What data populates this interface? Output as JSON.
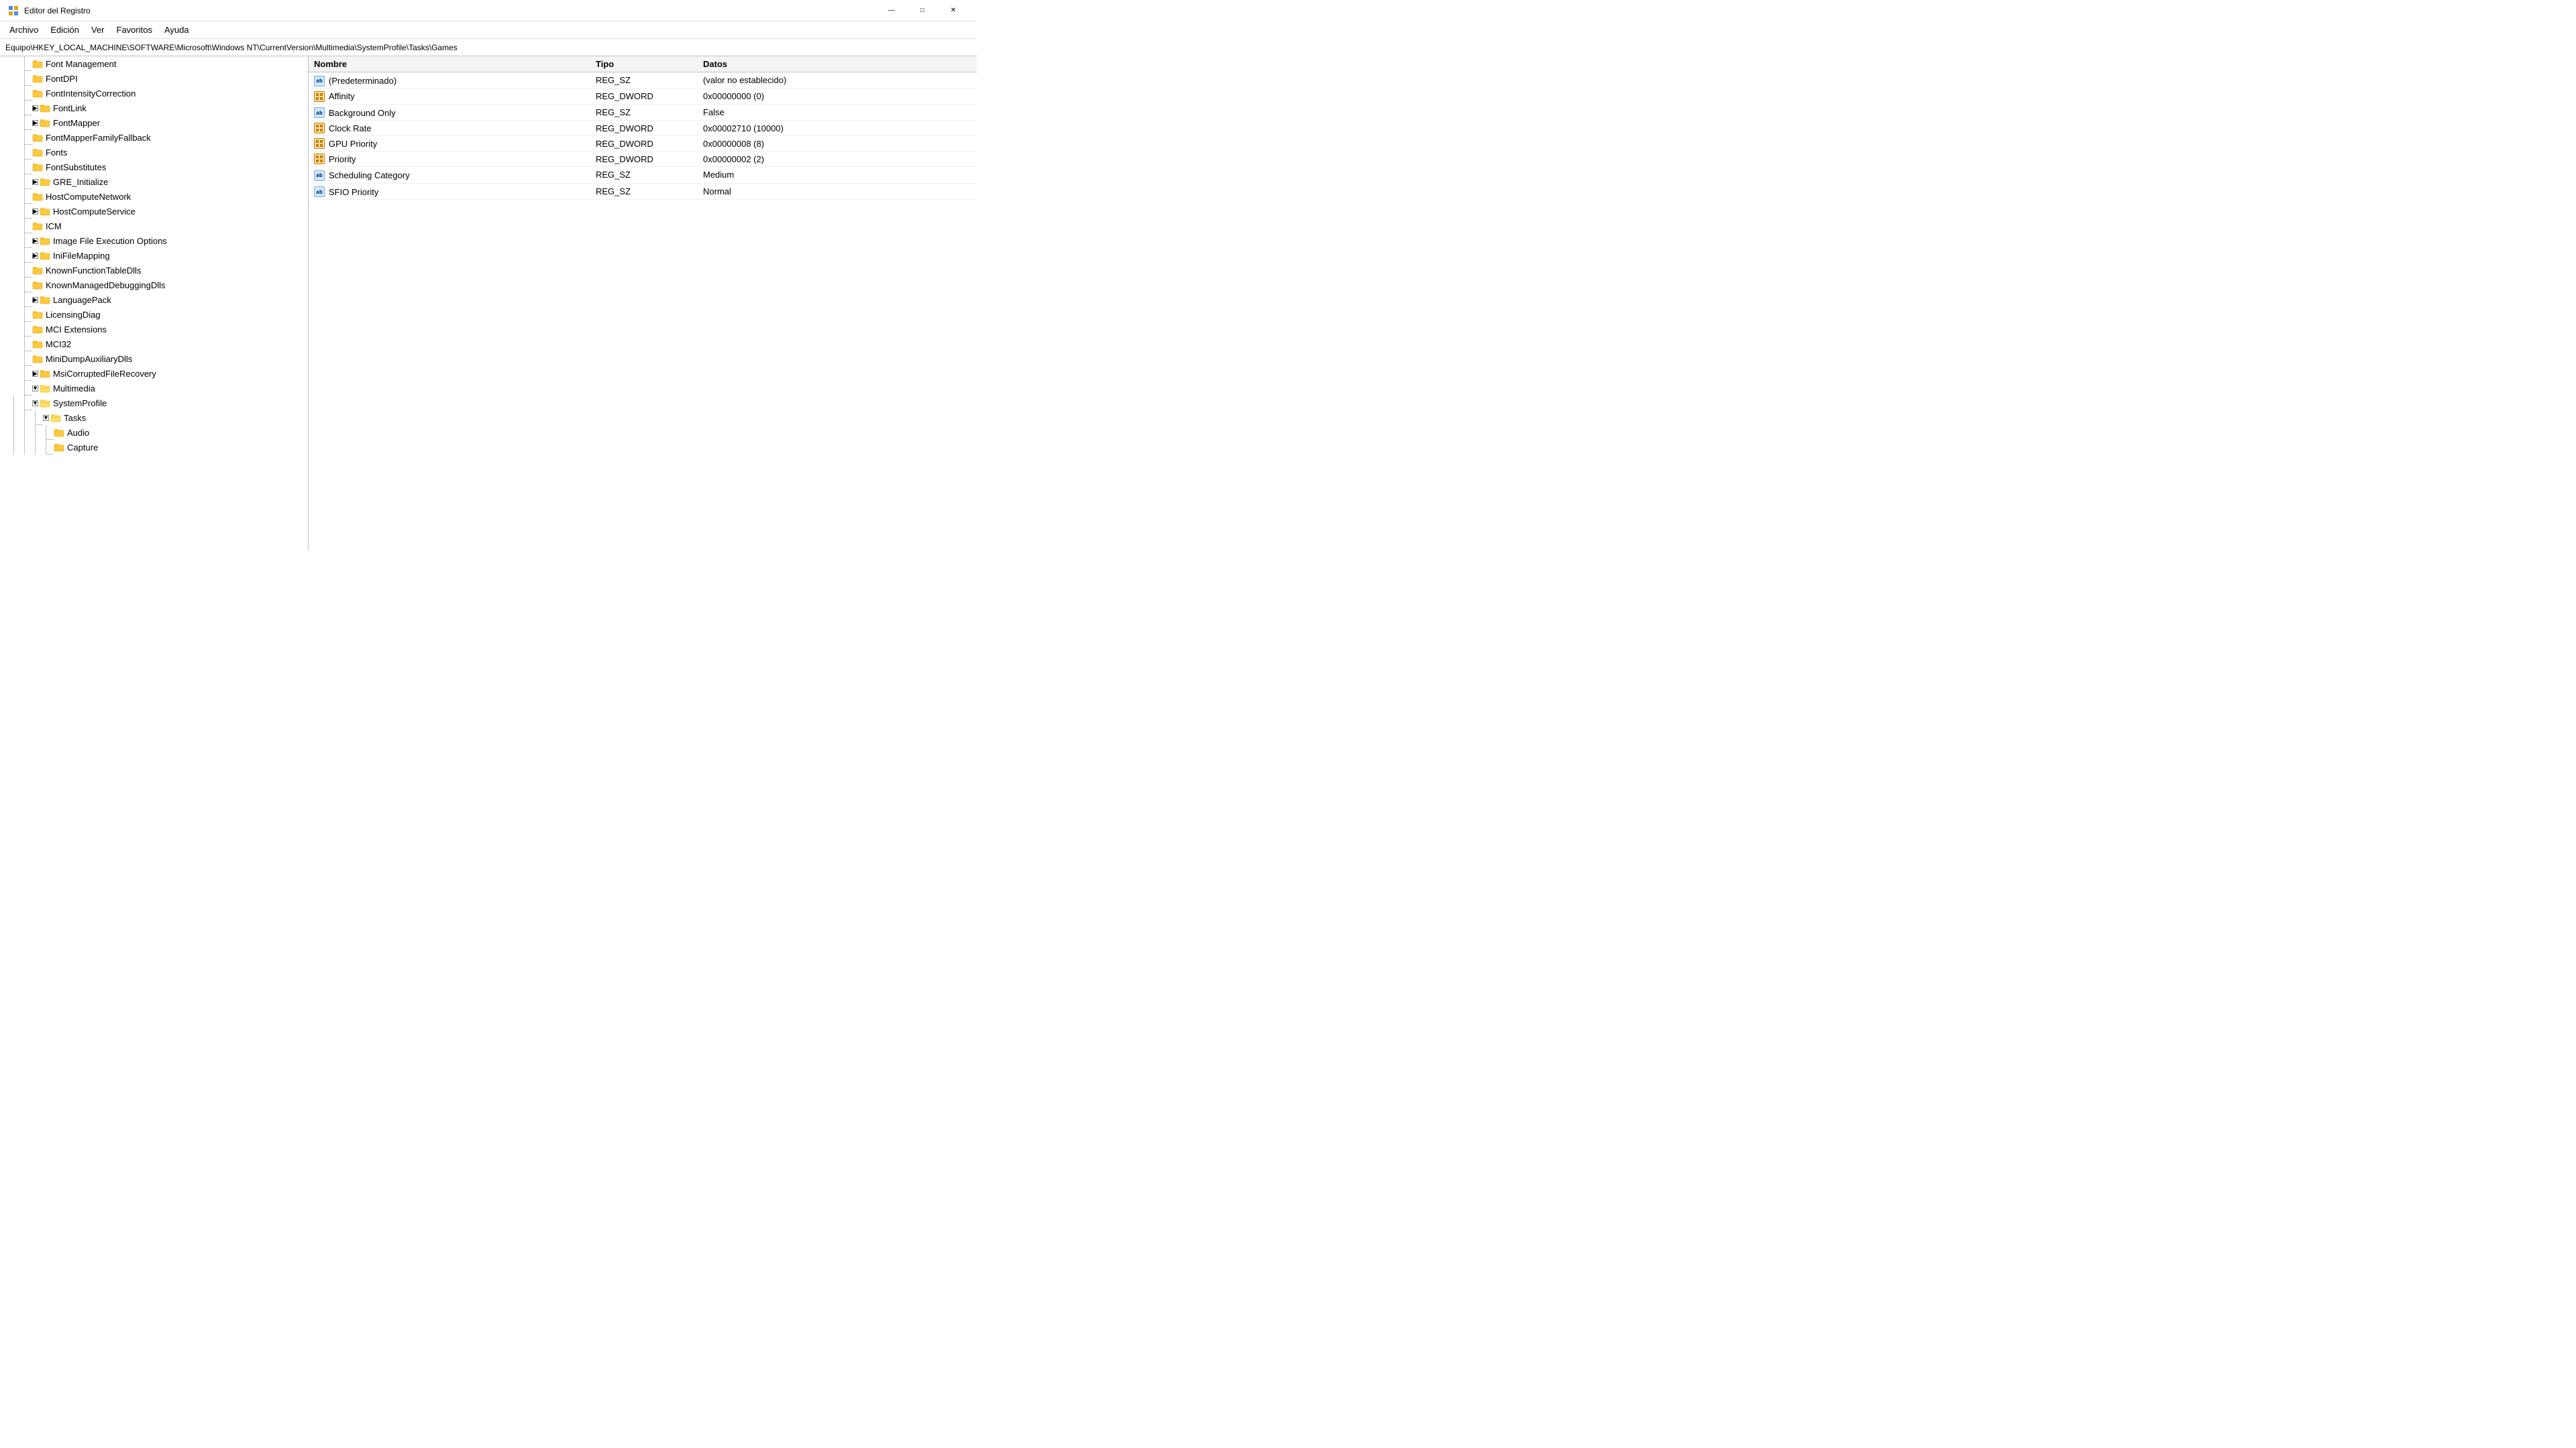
{
  "titleBar": {
    "icon": "registry-editor-icon",
    "title": "Editor del Registro",
    "minimizeBtn": "—",
    "maximizeBtn": "□",
    "closeBtn": "✕"
  },
  "menuBar": {
    "items": [
      "Archivo",
      "Edición",
      "Ver",
      "Favoritos",
      "Ayuda"
    ]
  },
  "breadcrumb": "Equipo\\HKEY_LOCAL_MACHINE\\SOFTWARE\\Microsoft\\Windows NT\\CurrentVersion\\Multimedia\\SystemProfile\\Tasks\\Games",
  "treePanel": {
    "items": [
      {
        "id": "font-management",
        "label": "Font Management",
        "depth": 1,
        "hasChildren": false,
        "expanded": false,
        "isLast": false
      },
      {
        "id": "fontdpi",
        "label": "FontDPI",
        "depth": 1,
        "hasChildren": false,
        "expanded": false,
        "isLast": false
      },
      {
        "id": "fontintensitycorrection",
        "label": "FontIntensityCorrection",
        "depth": 1,
        "hasChildren": false,
        "expanded": false,
        "isLast": false
      },
      {
        "id": "fontlink",
        "label": "FontLink",
        "depth": 1,
        "hasChildren": true,
        "expanded": false,
        "isLast": false
      },
      {
        "id": "fontmapper",
        "label": "FontMapper",
        "depth": 1,
        "hasChildren": true,
        "expanded": false,
        "isLast": false
      },
      {
        "id": "fontmapperfamilyfallback",
        "label": "FontMapperFamilyFallback",
        "depth": 1,
        "hasChildren": false,
        "expanded": false,
        "isLast": false
      },
      {
        "id": "fonts",
        "label": "Fonts",
        "depth": 1,
        "hasChildren": false,
        "expanded": false,
        "isLast": false
      },
      {
        "id": "fontsubstitutes",
        "label": "FontSubstitutes",
        "depth": 1,
        "hasChildren": false,
        "expanded": false,
        "isLast": false
      },
      {
        "id": "gre-initialize",
        "label": "GRE_Initialize",
        "depth": 1,
        "hasChildren": true,
        "expanded": false,
        "isLast": false
      },
      {
        "id": "hostcomputenetwork",
        "label": "HostComputeNetwork",
        "depth": 1,
        "hasChildren": false,
        "expanded": false,
        "isLast": false
      },
      {
        "id": "hostcomputeservice",
        "label": "HostComputeService",
        "depth": 1,
        "hasChildren": true,
        "expanded": false,
        "isLast": false
      },
      {
        "id": "icm",
        "label": "ICM",
        "depth": 1,
        "hasChildren": false,
        "expanded": false,
        "isLast": false
      },
      {
        "id": "imagefileexecutionoptions",
        "label": "Image File Execution Options",
        "depth": 1,
        "hasChildren": true,
        "expanded": false,
        "isLast": false
      },
      {
        "id": "inifilemapping",
        "label": "IniFileMapping",
        "depth": 1,
        "hasChildren": true,
        "expanded": false,
        "isLast": false
      },
      {
        "id": "knownfunctiontabledlls",
        "label": "KnownFunctionTableDlls",
        "depth": 1,
        "hasChildren": false,
        "expanded": false,
        "isLast": false
      },
      {
        "id": "knownmanageddebuggingdlls",
        "label": "KnownManagedDebuggingDlls",
        "depth": 1,
        "hasChildren": false,
        "expanded": false,
        "isLast": false
      },
      {
        "id": "languagepack",
        "label": "LanguagePack",
        "depth": 1,
        "hasChildren": true,
        "expanded": false,
        "isLast": false
      },
      {
        "id": "licensingdiag",
        "label": "LicensingDiag",
        "depth": 1,
        "hasChildren": false,
        "expanded": false,
        "isLast": false
      },
      {
        "id": "mciextensions",
        "label": "MCI Extensions",
        "depth": 1,
        "hasChildren": false,
        "expanded": false,
        "isLast": false
      },
      {
        "id": "mci32",
        "label": "MCI32",
        "depth": 1,
        "hasChildren": false,
        "expanded": false,
        "isLast": false
      },
      {
        "id": "minidumpauxiliarydlls",
        "label": "MiniDumpAuxiliaryDlls",
        "depth": 1,
        "hasChildren": false,
        "expanded": false,
        "isLast": false
      },
      {
        "id": "msicorruptedfilerecovery",
        "label": "MsiCorruptedFileRecovery",
        "depth": 1,
        "hasChildren": true,
        "expanded": false,
        "isLast": false
      },
      {
        "id": "multimedia",
        "label": "Multimedia",
        "depth": 1,
        "hasChildren": true,
        "expanded": true,
        "isLast": false
      },
      {
        "id": "systemprofile",
        "label": "SystemProfile",
        "depth": 2,
        "hasChildren": true,
        "expanded": true,
        "isLast": false
      },
      {
        "id": "tasks",
        "label": "Tasks",
        "depth": 3,
        "hasChildren": true,
        "expanded": true,
        "isLast": false
      },
      {
        "id": "audio",
        "label": "Audio",
        "depth": 4,
        "hasChildren": false,
        "expanded": false,
        "isLast": false
      },
      {
        "id": "capture",
        "label": "Capture",
        "depth": 4,
        "hasChildren": false,
        "expanded": false,
        "isLast": true
      }
    ]
  },
  "registryPanel": {
    "columns": {
      "name": "Nombre",
      "type": "Tipo",
      "data": "Datos"
    },
    "entries": [
      {
        "id": "predeterminado",
        "iconType": "ab",
        "name": "(Predeterminado)",
        "type": "REG_SZ",
        "data": "(valor no establecido)"
      },
      {
        "id": "affinity",
        "iconType": "dword",
        "name": "Affinity",
        "type": "REG_DWORD",
        "data": "0x00000000 (0)"
      },
      {
        "id": "background-only",
        "iconType": "ab",
        "name": "Background Only",
        "type": "REG_SZ",
        "data": "False"
      },
      {
        "id": "clock-rate",
        "iconType": "dword",
        "name": "Clock Rate",
        "type": "REG_DWORD",
        "data": "0x00002710 (10000)"
      },
      {
        "id": "gpu-priority",
        "iconType": "dword",
        "name": "GPU Priority",
        "type": "REG_DWORD",
        "data": "0x00000008 (8)"
      },
      {
        "id": "priority",
        "iconType": "dword",
        "name": "Priority",
        "type": "REG_DWORD",
        "data": "0x00000002 (2)"
      },
      {
        "id": "scheduling-category",
        "iconType": "ab",
        "name": "Scheduling Category",
        "type": "REG_SZ",
        "data": "Medium"
      },
      {
        "id": "sfio-priority",
        "iconType": "ab",
        "name": "SFIO Priority",
        "type": "REG_SZ",
        "data": "Normal"
      }
    ]
  }
}
